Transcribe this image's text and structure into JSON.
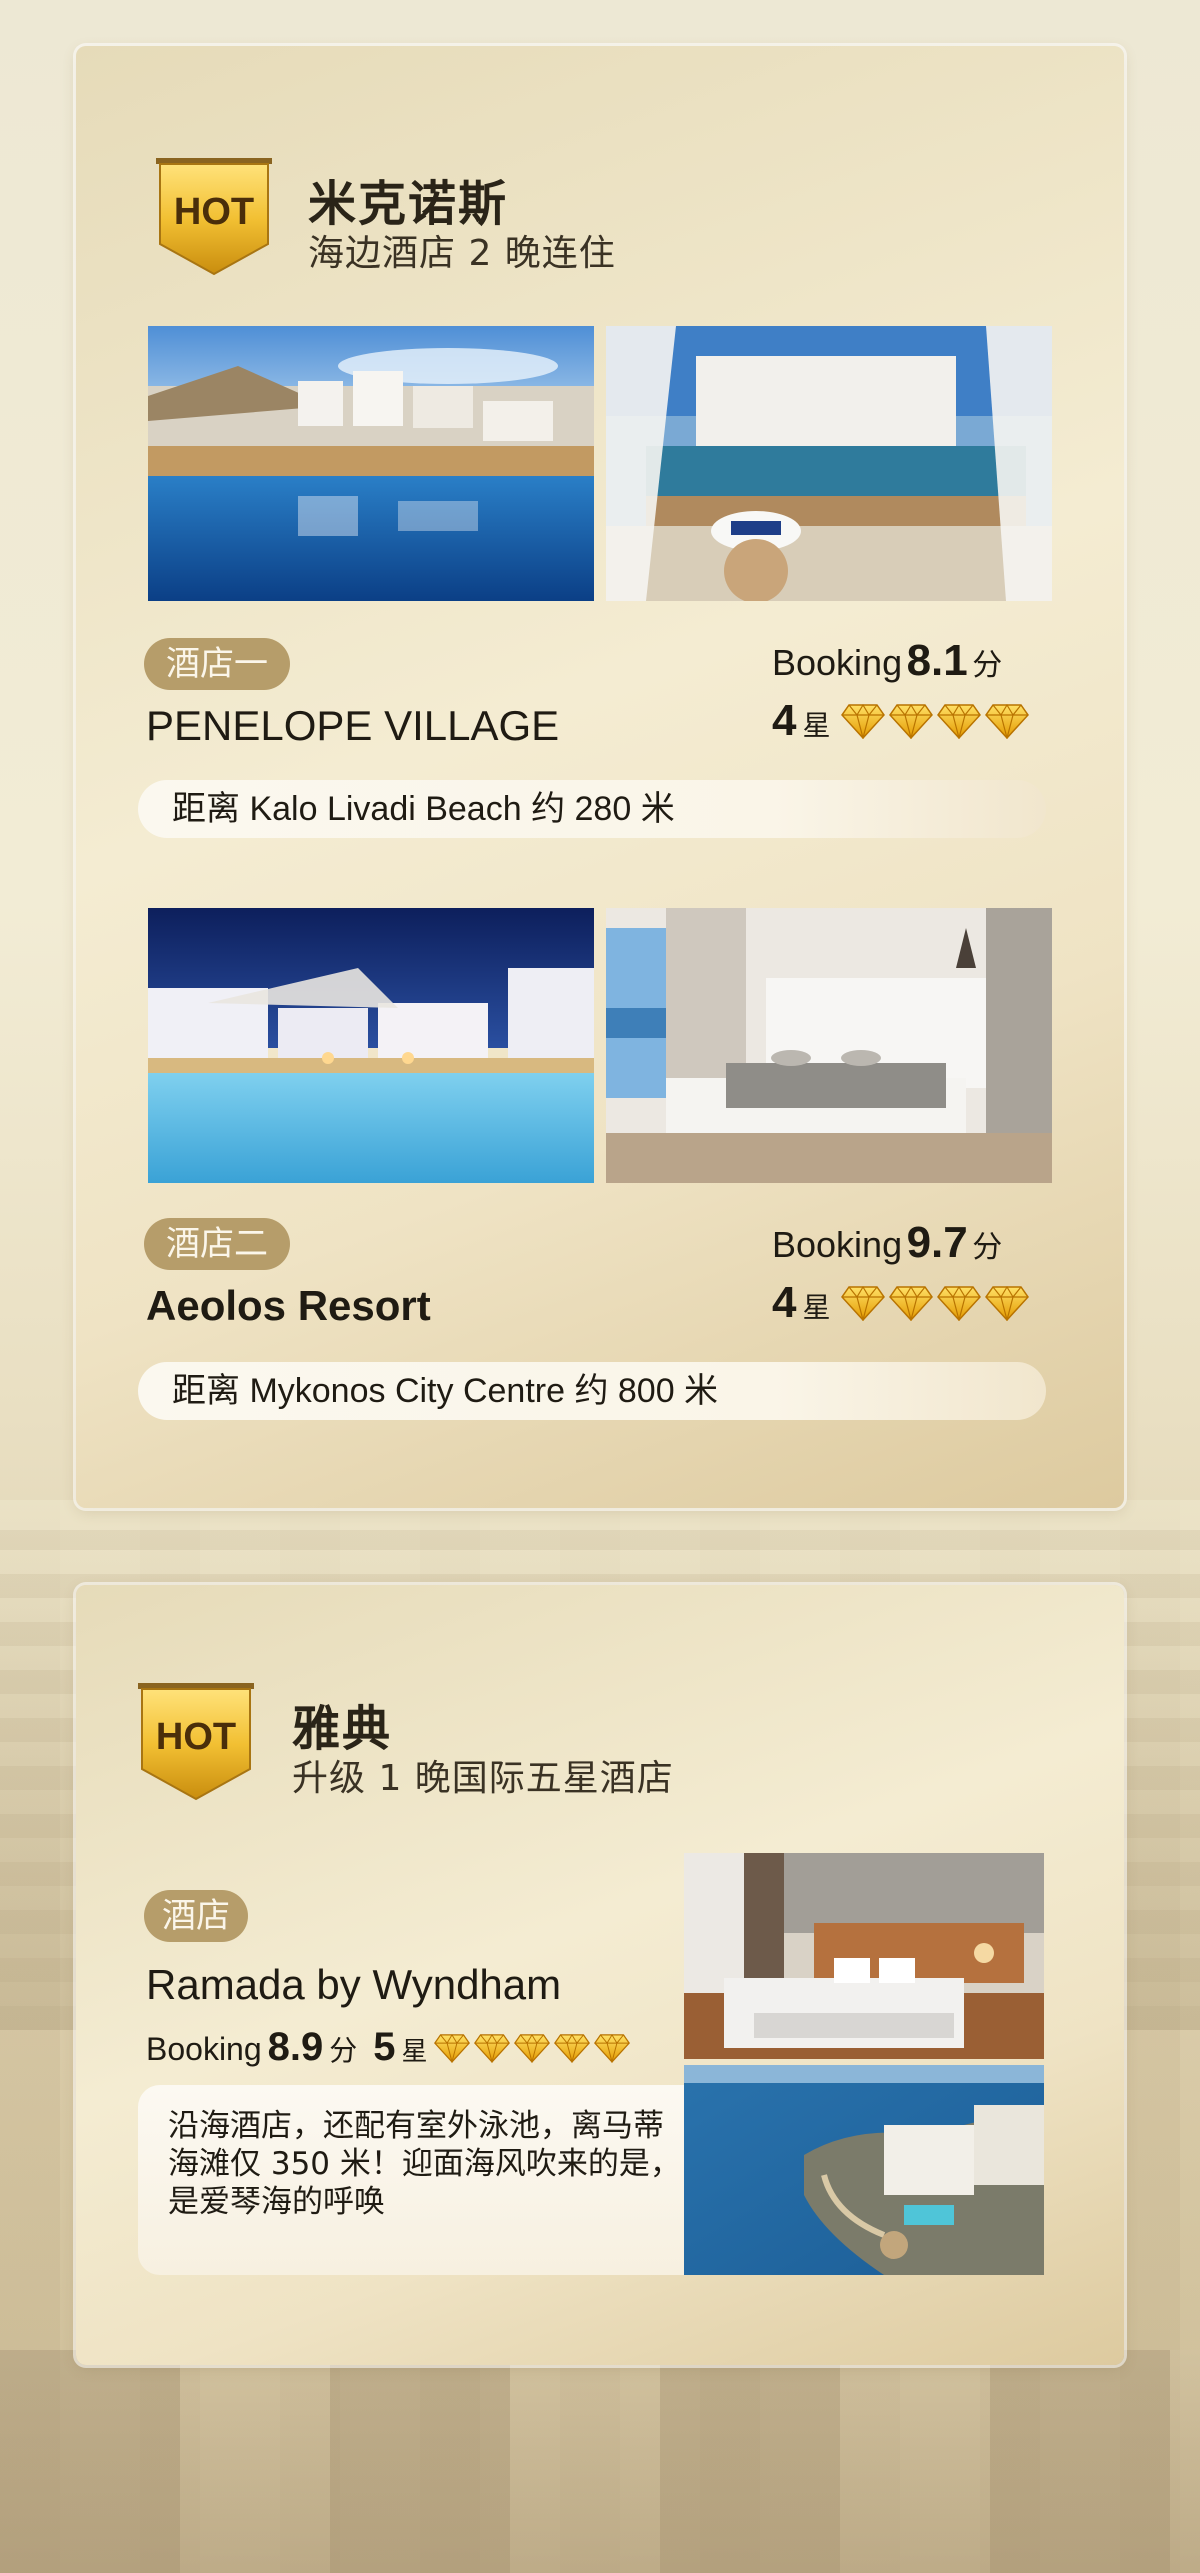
{
  "section1": {
    "badge": "HOT",
    "title": "米克诺斯",
    "subtitle": "海边酒店 2 晚连住",
    "hotels": [
      {
        "tag": "酒店一",
        "name": "PENELOPE VILLAGE",
        "booking_label": "Booking",
        "booking_score": "8.1",
        "score_unit": "分",
        "stars": "4",
        "star_unit": "星",
        "star_count": 4,
        "distance": "距离 Kalo Livadi Beach 约 280 米",
        "photos": [
          "pool-terrace-photo",
          "sea-view-lounge-photo"
        ]
      },
      {
        "tag": "酒店二",
        "name": "Aeolos Resort",
        "booking_label": "Booking",
        "booking_score": "9.7",
        "score_unit": "分",
        "stars": "4",
        "star_unit": "星",
        "star_count": 4,
        "distance": "距离 Mykonos City Centre 约 800 米",
        "photos": [
          "night-pool-photo",
          "white-bedroom-photo"
        ]
      }
    ]
  },
  "section2": {
    "badge": "HOT",
    "title": "雅典",
    "subtitle": "升级 1 晚国际五星酒店",
    "hotel": {
      "tag": "酒店",
      "name": "Ramada by Wyndham",
      "booking_label": "Booking",
      "booking_score": "8.9",
      "score_unit": "分",
      "stars": "5",
      "star_unit": "星",
      "star_count": 5,
      "description": "沿海酒店，还配有室外泳池，离马蒂海滩仅 350 米！迎面海风吹来的是，是爱琴海的呼唤",
      "photos": [
        "hotel-bedroom-photo",
        "coastal-aerial-photo"
      ]
    }
  },
  "colors": {
    "pill": "#b69d6a",
    "gold": "#e8b20a",
    "card": "#f4ecd2"
  }
}
